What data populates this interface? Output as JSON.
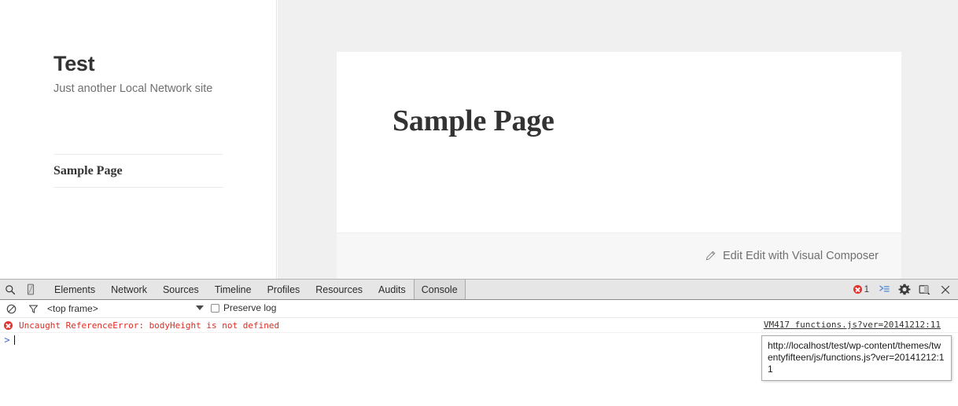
{
  "page": {
    "site_title": "Test",
    "tagline": "Just another Local Network site",
    "nav": [
      {
        "label": "Sample Page"
      }
    ],
    "entry_title": "Sample Page",
    "edit_link": "Edit Edit with Visual Composer",
    "pencil_icon": "pencil-icon"
  },
  "devtools": {
    "search_icon": "search-icon",
    "device_icon": "device-toggle-icon",
    "tabs": [
      {
        "label": "Elements",
        "active": false
      },
      {
        "label": "Network",
        "active": false
      },
      {
        "label": "Sources",
        "active": false
      },
      {
        "label": "Timeline",
        "active": false
      },
      {
        "label": "Profiles",
        "active": false
      },
      {
        "label": "Resources",
        "active": false
      },
      {
        "label": "Audits",
        "active": false
      },
      {
        "label": "Console",
        "active": true
      }
    ],
    "error_count": "1",
    "drawer_icon": "console-drawer-icon",
    "settings_icon": "gear-icon",
    "dock_icon": "dock-position-icon",
    "close_icon": "close-icon",
    "filterbar": {
      "clear_icon": "clear-console-icon",
      "filter_icon": "filter-funnel-icon",
      "frame_value": "<top frame>",
      "preserve_log_label": "Preserve log",
      "preserve_log_checked": false
    },
    "console": {
      "error_message": "Uncaught ReferenceError: bodyHeight is not defined",
      "source_link": "VM417 functions.js?ver=20141212:11",
      "prompt_chevron": ">",
      "prompt_value": "",
      "tooltip": "http://localhost/test/wp-content/themes/twentyfifteen/js/functions.js?ver=20141212:11"
    }
  },
  "colors": {
    "error_red": "#e02b20",
    "toolbar_gray": "#e6e6e6",
    "page_gray": "#f0f0f0",
    "footer_gray": "#f7f7f7"
  }
}
